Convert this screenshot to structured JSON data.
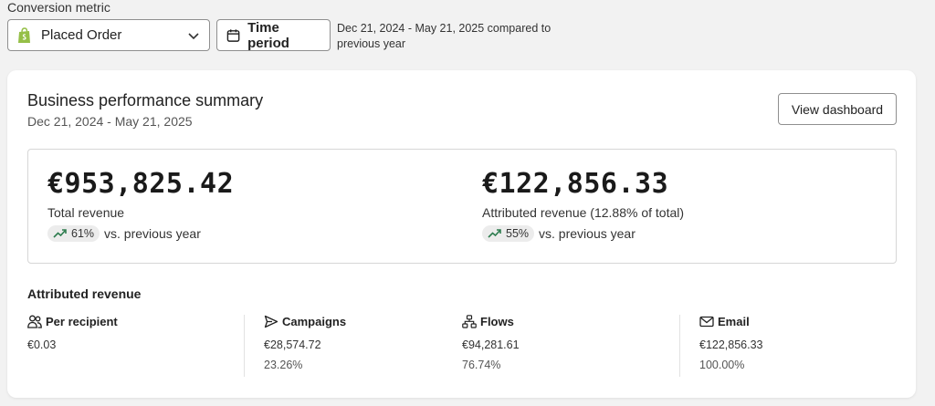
{
  "header": {
    "metric_label": "Conversion metric",
    "metric_value": "Placed Order",
    "time_period_label": "Time period",
    "period_text": "Dec 21, 2024 - May 21, 2025 compared to previous year"
  },
  "summary": {
    "title": "Business performance summary",
    "date_range": "Dec 21, 2024 - May 21, 2025",
    "view_button": "View dashboard",
    "total": {
      "amount": "€953,825.42",
      "label": "Total revenue",
      "change": "61%",
      "change_suffix": "vs. previous year"
    },
    "attributed": {
      "amount": "€122,856.33",
      "label": "Attributed revenue (12.88% of total)",
      "change": "55%",
      "change_suffix": "vs. previous year"
    }
  },
  "attributed_revenue": {
    "title": "Attributed revenue",
    "columns": [
      {
        "label": "Per recipient",
        "icon": "people-icon",
        "value": "€0.03",
        "percent": ""
      },
      {
        "label": "Campaigns",
        "icon": "send-icon",
        "value": "€28,574.72",
        "percent": "23.26%"
      },
      {
        "label": "Flows",
        "icon": "flows-icon",
        "value": "€94,281.61",
        "percent": "76.74%"
      },
      {
        "label": "Email",
        "icon": "mail-icon",
        "value": "€122,856.33",
        "percent": "100.00%"
      }
    ]
  },
  "colors": {
    "trend_green": "#2e7d4f",
    "shopify_green": "#95bf47"
  }
}
